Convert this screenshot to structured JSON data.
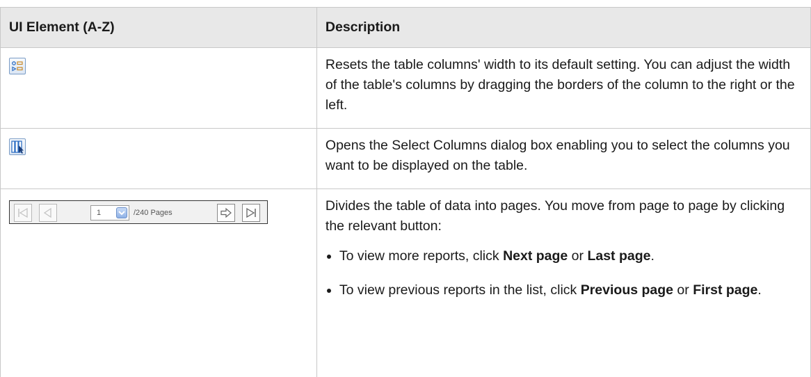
{
  "table": {
    "headers": [
      "UI Element (A-Z)",
      "Description"
    ],
    "rows": [
      {
        "element_icon": "reset-columns-width-icon",
        "description": "Resets the table columns' width to its default setting. You can adjust the width of the table's columns by dragging the borders of the column to the right or the left."
      },
      {
        "element_icon": "select-columns-icon",
        "description": "Opens the Select Columns dialog box enabling you to select the columns you want to be displayed on the table."
      },
      {
        "element_icon": "pager-widget",
        "pager": {
          "page_value": "1",
          "pages_label": "/240 Pages"
        },
        "description": "Divides the table of data into pages. You move from page to page by clicking the relevant button:",
        "bullets": [
          {
            "pre": "To view more reports, click ",
            "b1": "Next page",
            "mid": " or ",
            "b2": "Last page",
            "post": "."
          },
          {
            "pre": "To view previous reports in the list, click ",
            "b1": "Previous page",
            "mid": " or ",
            "b2": "First page",
            "post": "."
          }
        ]
      }
    ]
  },
  "colors": {
    "header_bg": "#e8e8e8",
    "border": "#c8c8c8",
    "icon_blue": "#2f6fc4"
  }
}
